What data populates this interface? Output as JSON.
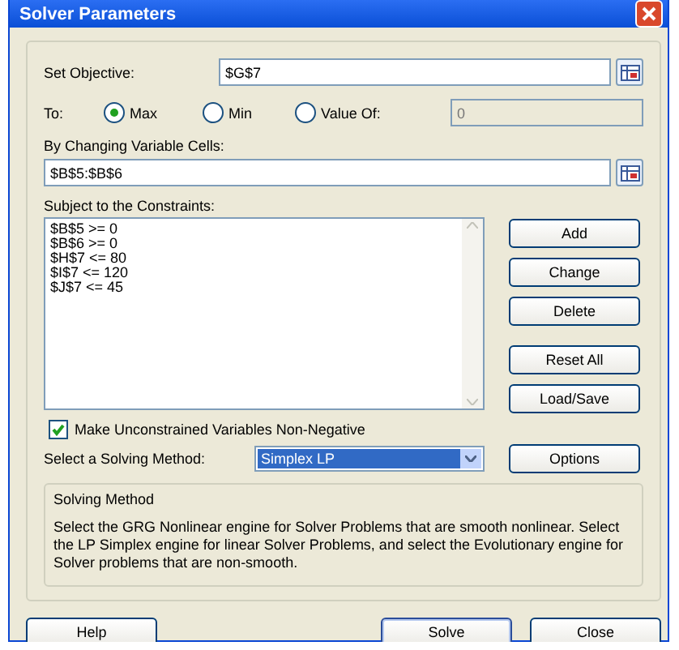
{
  "window": {
    "title": "Solver Parameters"
  },
  "objective": {
    "label": "Set Objective:",
    "value": "$G$7"
  },
  "to": {
    "label": "To:",
    "options": [
      {
        "label": "Max",
        "selected": true
      },
      {
        "label": "Min",
        "selected": false
      },
      {
        "label": "Value Of:",
        "selected": false
      }
    ],
    "value": "0"
  },
  "variables": {
    "label": "By Changing Variable Cells:",
    "value": "$B$5:$B$6"
  },
  "constraints": {
    "label": "Subject to the Constraints:",
    "items": [
      "$B$5 >= 0",
      "$B$6 >= 0",
      "$H$7 <= 80",
      "$I$7 <= 120",
      "$J$7 <= 45"
    ]
  },
  "constraint_buttons": [
    [
      "Add",
      "Change",
      "Delete"
    ],
    [
      "Reset All",
      "Load/Save"
    ]
  ],
  "nonnegative": {
    "label": "Make Unconstrained Variables Non-Negative",
    "checked": true
  },
  "method": {
    "label": "Select a Solving Method:",
    "value": "Simplex LP",
    "button": "Options"
  },
  "method_info": {
    "title": "Solving Method",
    "text": "Select the GRG Nonlinear engine for Solver Problems that are smooth nonlinear. Select the LP Simplex engine for linear Solver Problems, and select the Evolutionary engine for Solver problems that are non-smooth."
  },
  "footer": {
    "help": "Help",
    "solve": "Solve",
    "close": "Close"
  }
}
